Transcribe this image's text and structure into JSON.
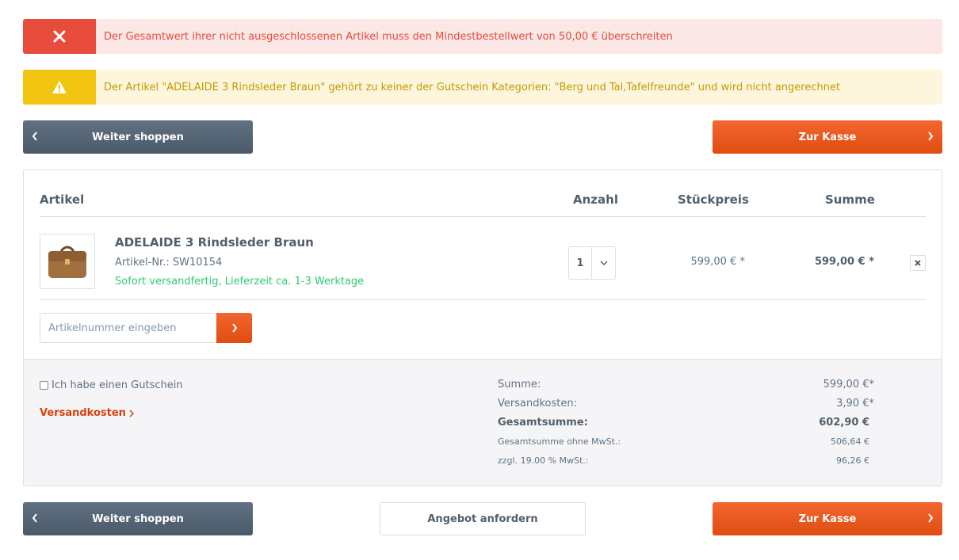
{
  "alerts": {
    "error": {
      "text": "Der Gesamtwert ihrer nicht ausgeschlossenen Artikel muss den Mindestbestellwert von 50,00 € überschreiten",
      "icon": "close-icon",
      "color": "#e74c3c"
    },
    "warning": {
      "text": "Der Artikel \"ADELAIDE 3 Rindsleder Braun\" gehört zu keiner der Gutschein Kategorien: \"Berg und Tal,Tafelfreunde\" und wird nicht angerechnet",
      "icon": "warning-icon",
      "color": "#f1c40f"
    }
  },
  "actions": {
    "continue_shopping": "Weiter shoppen",
    "checkout": "Zur Kasse",
    "request_offer": "Angebot anfordern"
  },
  "cart": {
    "headers": {
      "article": "Artikel",
      "quantity": "Anzahl",
      "unit_price": "Stückpreis",
      "total": "Summe"
    },
    "items": [
      {
        "name": "ADELAIDE 3 Rindsleder Braun",
        "sku": "Artikel-Nr.: SW10154",
        "delivery": "Sofort versandfertig, Lieferzeit ca. 1-3 Werktage",
        "quantity": "1",
        "unit_price": "599,00 € *",
        "total": "599,00 € *"
      }
    ],
    "add_article": {
      "placeholder": "Artikelnummer eingeben"
    }
  },
  "footer": {
    "voucher_label": "Ich habe einen Gutschein",
    "shipping_link": "Versandkosten",
    "aggregations": {
      "sum_label": "Summe:",
      "sum_value": "599,00 €*",
      "shipping_label": "Versandkosten:",
      "shipping_value": "3,90 €*",
      "grand_total_label": "Gesamtsumme:",
      "grand_total_value": "602,90 €",
      "net_label": "Gesamtsumme ohne MwSt.:",
      "net_value": "506,64 €",
      "tax_label": "zzgl. 19.00 % MwSt.:",
      "tax_value": "96,26 €"
    }
  },
  "colors": {
    "accent": "#e04d10",
    "dark_button": "#4b5a69",
    "delivery_green": "#2ecc71",
    "error": "#e74c3c",
    "warning": "#f1c40f"
  }
}
